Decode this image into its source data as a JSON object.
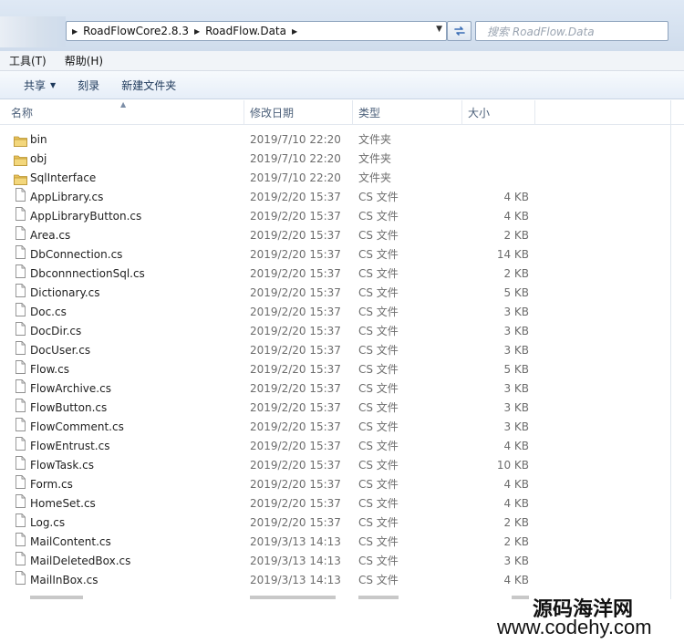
{
  "address_bar": {
    "breadcrumbs": [
      "RoadFlowCore2.8.3",
      "RoadFlow.Data"
    ],
    "search_placeholder": "搜索 RoadFlow.Data"
  },
  "menu": [
    "工具(T)",
    "帮助(H)"
  ],
  "toolbar": {
    "share": "共享",
    "burn": "刻录",
    "new_folder": "新建文件夹"
  },
  "columns": {
    "name": "名称",
    "modified": "修改日期",
    "type": "类型",
    "size": "大小"
  },
  "files": [
    {
      "name": "bin",
      "modified": "2019/7/10 22:20",
      "type": "文件夹",
      "size": "",
      "icon": "folder-icon"
    },
    {
      "name": "obj",
      "modified": "2019/7/10 22:20",
      "type": "文件夹",
      "size": "",
      "icon": "folder-icon"
    },
    {
      "name": "SqlInterface",
      "modified": "2019/7/10 22:20",
      "type": "文件夹",
      "size": "",
      "icon": "folder-icon"
    },
    {
      "name": "AppLibrary.cs",
      "modified": "2019/2/20 15:37",
      "type": "CS 文件",
      "size": "4 KB",
      "icon": "file-icon"
    },
    {
      "name": "AppLibraryButton.cs",
      "modified": "2019/2/20 15:37",
      "type": "CS 文件",
      "size": "4 KB",
      "icon": "file-icon"
    },
    {
      "name": "Area.cs",
      "modified": "2019/2/20 15:37",
      "type": "CS 文件",
      "size": "2 KB",
      "icon": "file-icon"
    },
    {
      "name": "DbConnection.cs",
      "modified": "2019/2/20 15:37",
      "type": "CS 文件",
      "size": "14 KB",
      "icon": "file-icon"
    },
    {
      "name": "DbconnnectionSql.cs",
      "modified": "2019/2/20 15:37",
      "type": "CS 文件",
      "size": "2 KB",
      "icon": "file-icon"
    },
    {
      "name": "Dictionary.cs",
      "modified": "2019/2/20 15:37",
      "type": "CS 文件",
      "size": "5 KB",
      "icon": "file-icon"
    },
    {
      "name": "Doc.cs",
      "modified": "2019/2/20 15:37",
      "type": "CS 文件",
      "size": "3 KB",
      "icon": "file-icon"
    },
    {
      "name": "DocDir.cs",
      "modified": "2019/2/20 15:37",
      "type": "CS 文件",
      "size": "3 KB",
      "icon": "file-icon"
    },
    {
      "name": "DocUser.cs",
      "modified": "2019/2/20 15:37",
      "type": "CS 文件",
      "size": "3 KB",
      "icon": "file-icon"
    },
    {
      "name": "Flow.cs",
      "modified": "2019/2/20 15:37",
      "type": "CS 文件",
      "size": "5 KB",
      "icon": "file-icon"
    },
    {
      "name": "FlowArchive.cs",
      "modified": "2019/2/20 15:37",
      "type": "CS 文件",
      "size": "3 KB",
      "icon": "file-icon"
    },
    {
      "name": "FlowButton.cs",
      "modified": "2019/2/20 15:37",
      "type": "CS 文件",
      "size": "3 KB",
      "icon": "file-icon"
    },
    {
      "name": "FlowComment.cs",
      "modified": "2019/2/20 15:37",
      "type": "CS 文件",
      "size": "3 KB",
      "icon": "file-icon"
    },
    {
      "name": "FlowEntrust.cs",
      "modified": "2019/2/20 15:37",
      "type": "CS 文件",
      "size": "4 KB",
      "icon": "file-icon"
    },
    {
      "name": "FlowTask.cs",
      "modified": "2019/2/20 15:37",
      "type": "CS 文件",
      "size": "10 KB",
      "icon": "file-icon"
    },
    {
      "name": "Form.cs",
      "modified": "2019/2/20 15:37",
      "type": "CS 文件",
      "size": "4 KB",
      "icon": "file-icon"
    },
    {
      "name": "HomeSet.cs",
      "modified": "2019/2/20 15:37",
      "type": "CS 文件",
      "size": "4 KB",
      "icon": "file-icon"
    },
    {
      "name": "Log.cs",
      "modified": "2019/2/20 15:37",
      "type": "CS 文件",
      "size": "2 KB",
      "icon": "file-icon"
    },
    {
      "name": "MailContent.cs",
      "modified": "2019/3/13 14:13",
      "type": "CS 文件",
      "size": "2 KB",
      "icon": "file-icon"
    },
    {
      "name": "MailDeletedBox.cs",
      "modified": "2019/3/13 14:13",
      "type": "CS 文件",
      "size": "3 KB",
      "icon": "file-icon"
    },
    {
      "name": "MailInBox.cs",
      "modified": "2019/3/13 14:13",
      "type": "CS 文件",
      "size": "4 KB",
      "icon": "file-icon"
    }
  ],
  "watermark": {
    "cn": "源码海洋网",
    "url": "www.codehy.com"
  }
}
